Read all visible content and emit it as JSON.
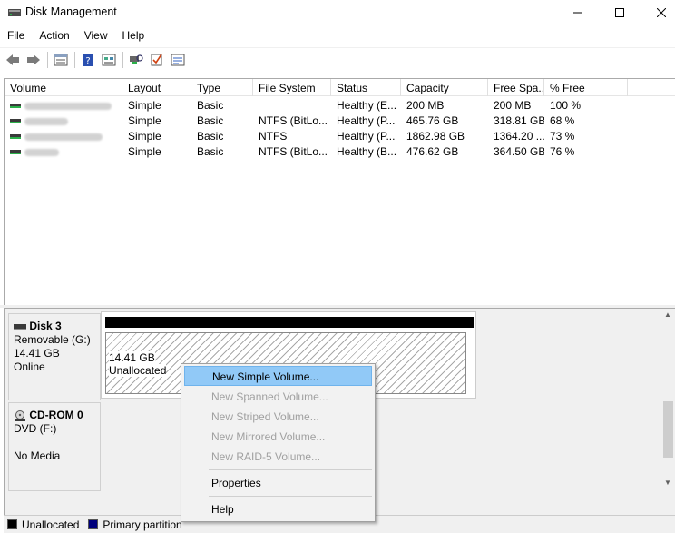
{
  "window": {
    "title": "Disk Management",
    "menu": [
      "File",
      "Action",
      "View",
      "Help"
    ]
  },
  "toolbar": {
    "icons": [
      "back-icon",
      "forward-icon",
      "disk-list-icon",
      "help-icon",
      "properties-icon",
      "rescan-icon",
      "check-icon",
      "settings-icon"
    ]
  },
  "volume_table": {
    "columns": [
      "Volume",
      "Layout",
      "Type",
      "File System",
      "Status",
      "Capacity",
      "Free Spa...",
      "% Free"
    ],
    "rows": [
      {
        "layout": "Simple",
        "type": "Basic",
        "fs": "",
        "status": "Healthy (E...",
        "capacity": "200 MB",
        "free": "200 MB",
        "pct": "100 %"
      },
      {
        "layout": "Simple",
        "type": "Basic",
        "fs": "NTFS (BitLo...",
        "status": "Healthy (P...",
        "capacity": "465.76 GB",
        "free": "318.81 GB",
        "pct": "68 %"
      },
      {
        "layout": "Simple",
        "type": "Basic",
        "fs": "NTFS",
        "status": "Healthy (P...",
        "capacity": "1862.98 GB",
        "free": "1364.20 ...",
        "pct": "73 %"
      },
      {
        "layout": "Simple",
        "type": "Basic",
        "fs": "NTFS (BitLo...",
        "status": "Healthy (B...",
        "capacity": "476.62 GB",
        "free": "364.50 GB",
        "pct": "76 %"
      }
    ]
  },
  "disks": [
    {
      "name": "Disk 3",
      "line1": "Removable (G:)",
      "line2": "14.41 GB",
      "line3": "Online",
      "partition_size": "14.41 GB",
      "partition_label": "Unallocated"
    },
    {
      "name": "CD-ROM 0",
      "line1": "DVD (F:)",
      "line2": "",
      "line3": "No Media"
    }
  ],
  "legend": {
    "unallocated": "Unallocated",
    "primary": "Primary partition",
    "colors": {
      "unallocated": "#000000",
      "primary": "#00007b"
    }
  },
  "context_menu": {
    "items": [
      {
        "label": "New Simple Volume...",
        "state": "selected"
      },
      {
        "label": "New Spanned Volume...",
        "state": "disabled"
      },
      {
        "label": "New Striped Volume...",
        "state": "disabled"
      },
      {
        "label": "New Mirrored Volume...",
        "state": "disabled"
      },
      {
        "label": "New RAID-5 Volume...",
        "state": "disabled"
      },
      {
        "label": "Properties",
        "state": "enabled"
      },
      {
        "label": "Help",
        "state": "enabled"
      }
    ]
  }
}
